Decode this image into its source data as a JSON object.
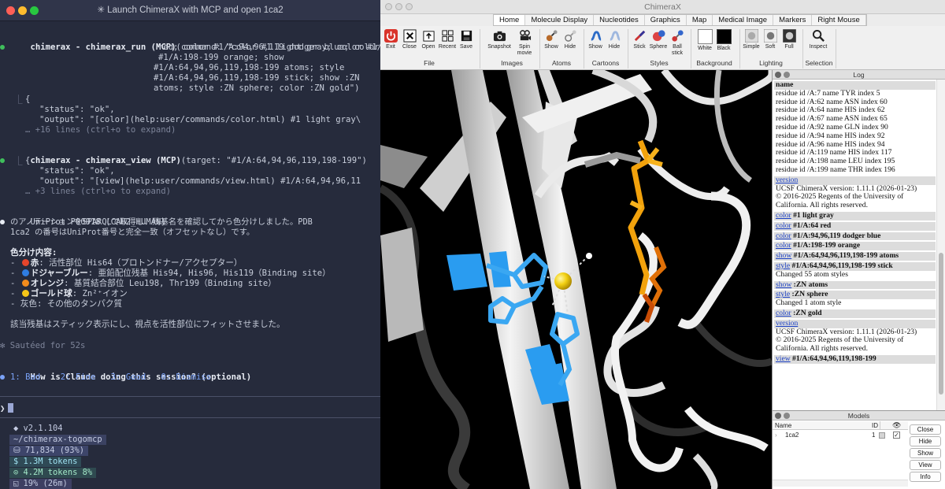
{
  "terminal": {
    "title": "✳ Launch ChimeraX with MCP and open 1ca2",
    "run_call": {
      "tool": "chimerax - chimerax_run (MCP)",
      "args": [
        "(command: \"color #1 light gray; color #1/A:64",
        "red; color #1/A:94,96,119 dodger blue; color",
        "#1/A:198-199 orange; show",
        "#1/A:64,94,96,119,198-199 atoms; style",
        "#1/A:64,94,96,119,198-199 stick; show :ZN",
        "atoms; style :ZN sphere; color :ZN gold\")"
      ],
      "result": [
        "{",
        "\"status\": \"ok\",",
        "\"output\": \"[color](help:user/commands/color.html) #1 light gray\\"
      ],
      "more": "… +16 lines (ctrl+o to expand)"
    },
    "view_call": {
      "tool": "chimerax - chimerax_view (MCP)",
      "args": "(target: \"#1/A:64,94,96,119,198-199\")",
      "result": [
        "{",
        "\"status\": \"ok\",",
        "\"output\": \"[view](help:user/commands/view.html) #1/A:64,94,96,11"
      ],
      "more": "… +3 lines (ctrl+o to expand)"
    },
    "answer": {
      "lines": [
        "UniProt P00918 (CAH2_HUMAN)",
        "のアノテーションをSPARQLで取得し、残基名を確認してから色分けしました。PDB",
        "1ca2 の番号はUniProt番号と完全一致（オフセットなし）です。"
      ],
      "legend_title": "色分け内容:",
      "legend": [
        {
          "color": "#e5452b",
          "name": "赤",
          "desc": ": 活性部位 His64（プロトンドナー/アクセプター）"
        },
        {
          "color": "#2f7de1",
          "name": "ドジャーブルー",
          "desc": ": 亜鉛配位残基 His94, His96, His119（Binding site）"
        },
        {
          "color": "#f28c1c",
          "name": "オレンジ",
          "desc": ": 基質結合部位 Leu198, Thr199（Binding site）"
        },
        {
          "color": "#f5c518",
          "name": "ゴールド球",
          "desc": ": Zn²⁺イオン"
        }
      ],
      "legend_gray": "- 灰色: その他のタンパク質",
      "closing": "該当残基はスティック表示にし、視点を活性部位にフィットさせました。"
    },
    "sauteed": "✻ Sautéed for 52s",
    "feedback_q": "How is Claude doing this session? (optional)",
    "feedback_opts": "1: Bad    2: Fine   3: Good   0: Dismiss",
    "prompt_symbol": "❯",
    "status": [
      "◆ v2.1.104",
      "~/chimerax-togomcp",
      "⛁ 71,834 (93%)",
      "$ 1.3M tokens",
      "⊙ 4.2M tokens 8%",
      "◱ 19% (26m)"
    ]
  },
  "chimerax": {
    "title": "ChimeraX",
    "tabs": [
      "Home",
      "Molecule Display",
      "Nucleotides",
      "Graphics",
      "Map",
      "Medical Image",
      "Markers",
      "Right Mouse"
    ],
    "tools": {
      "exit": "Exit",
      "close": "Close",
      "open": "Open",
      "recent": "Recent",
      "save": "Save",
      "snapshot": "Snapshot",
      "spin_movie": "Spin movie",
      "show_atoms": "Show",
      "hide_atoms": "Hide",
      "show_cartoon": "Show",
      "hide_cartoon": "Hide",
      "stick": "Stick",
      "sphere": "Sphere",
      "ball_stick": "Ball stick",
      "white": "White",
      "black": "Black",
      "simple": "Simple",
      "soft": "Soft",
      "full": "Full",
      "inspect": "Inspect"
    },
    "groups": [
      "File",
      "Images",
      "Atoms",
      "Cartoons",
      "Styles",
      "Background",
      "Lighting",
      "Selection"
    ],
    "log_title": "Log",
    "log_heading": "name",
    "residues": [
      "residue id /A:7 name TYR index 5",
      "residue id /A:62 name ASN index 60",
      "residue id /A:64 name HIS index 62",
      "residue id /A:67 name ASN index 65",
      "residue id /A:92 name GLN index 90",
      "residue id /A:94 name HIS index 92",
      "residue id /A:96 name HIS index 94",
      "residue id /A:119 name HIS index 117",
      "residue id /A:198 name LEU index 195",
      "residue id /A:199 name THR index 196"
    ],
    "version_link": "version",
    "version_text": "UCSF ChimeraX version: 1.11.1 (2026-01-23)",
    "copyright": "© 2016-2025 Regents of the University of California. All rights reserved.",
    "log_cmds": [
      {
        "link": "color",
        "rest": " #1 light gray",
        "note": ""
      },
      {
        "link": "color",
        "rest": " #1/A:64 red",
        "note": ""
      },
      {
        "link": "color",
        "rest": " #1/A:94,96,119 dodger blue",
        "note": ""
      },
      {
        "link": "color",
        "rest": " #1/A:198-199 orange",
        "note": ""
      },
      {
        "link": "show",
        "rest": " #1/A:64,94,96,119,198-199 atoms",
        "note": ""
      },
      {
        "link": "style",
        "rest": " #1/A:64,94,96,119,198-199 stick",
        "note": "Changed 55 atom styles"
      },
      {
        "link": "show",
        "rest": " :ZN atoms",
        "note": ""
      },
      {
        "link": "style",
        "rest": " :ZN sphere",
        "note": "Changed 1 atom style"
      },
      {
        "link": "color",
        "rest": " :ZN gold",
        "note": ""
      }
    ],
    "view_cmd": {
      "link": "view",
      "rest": " #1/A:64,94,96,119,198-199"
    },
    "models_title": "Models",
    "models_cols": [
      "Name",
      "ID"
    ],
    "model_row": {
      "name": "1ca2",
      "id": "1"
    },
    "model_buttons": [
      "Close",
      "Hide",
      "Show",
      "View",
      "Info"
    ]
  }
}
